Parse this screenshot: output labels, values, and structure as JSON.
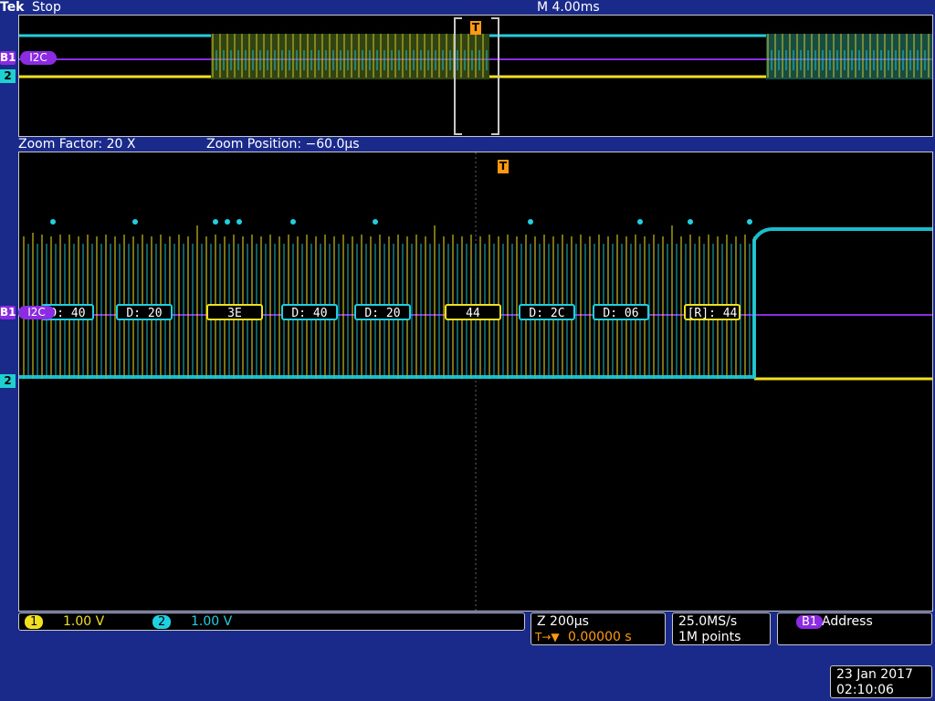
{
  "header": {
    "brand": "Tek",
    "run_state": "Stop",
    "timebase": "M 4.00ms"
  },
  "zoom": {
    "factor_label": "Zoom Factor: 20 X",
    "position_label": "Zoom Position: −60.0µs"
  },
  "markers": {
    "trigger": "T",
    "bus": "B1",
    "bus_name": "I2C",
    "channel2": "2"
  },
  "packets": [
    {
      "text": "D: 40",
      "kind": "data"
    },
    {
      "text": "D: 20",
      "kind": "data"
    },
    {
      "text": "3E",
      "kind": "addr"
    },
    {
      "text": "D: 40",
      "kind": "data"
    },
    {
      "text": "D: 20",
      "kind": "data"
    },
    {
      "text": "44",
      "kind": "addr"
    },
    {
      "text": "D: 2C",
      "kind": "data"
    },
    {
      "text": "D: 06",
      "kind": "data"
    },
    {
      "text": "[R]: 44",
      "kind": "addr"
    }
  ],
  "channels": {
    "ch1_num": "1",
    "ch1_scale": "1.00 V",
    "ch2_num": "2",
    "ch2_scale": "1.00 V"
  },
  "horizontal": {
    "zoom_scale": "Z 200µs",
    "trigger_pos": "0.00000 s",
    "trigger_prefix": "T→▼"
  },
  "acquisition": {
    "sample_rate": "25.0MS/s",
    "record_length": "1M points"
  },
  "trigger_info": {
    "source": "B1",
    "type": "Address"
  },
  "datetime": {
    "date": "23 Jan  2017",
    "time": "02:10:06"
  },
  "colors": {
    "ch1": "#f0e020",
    "ch2": "#20d0e0",
    "bus": "#8b2be2",
    "trigger": "#ff9a10",
    "background": "#1a2a8a"
  }
}
